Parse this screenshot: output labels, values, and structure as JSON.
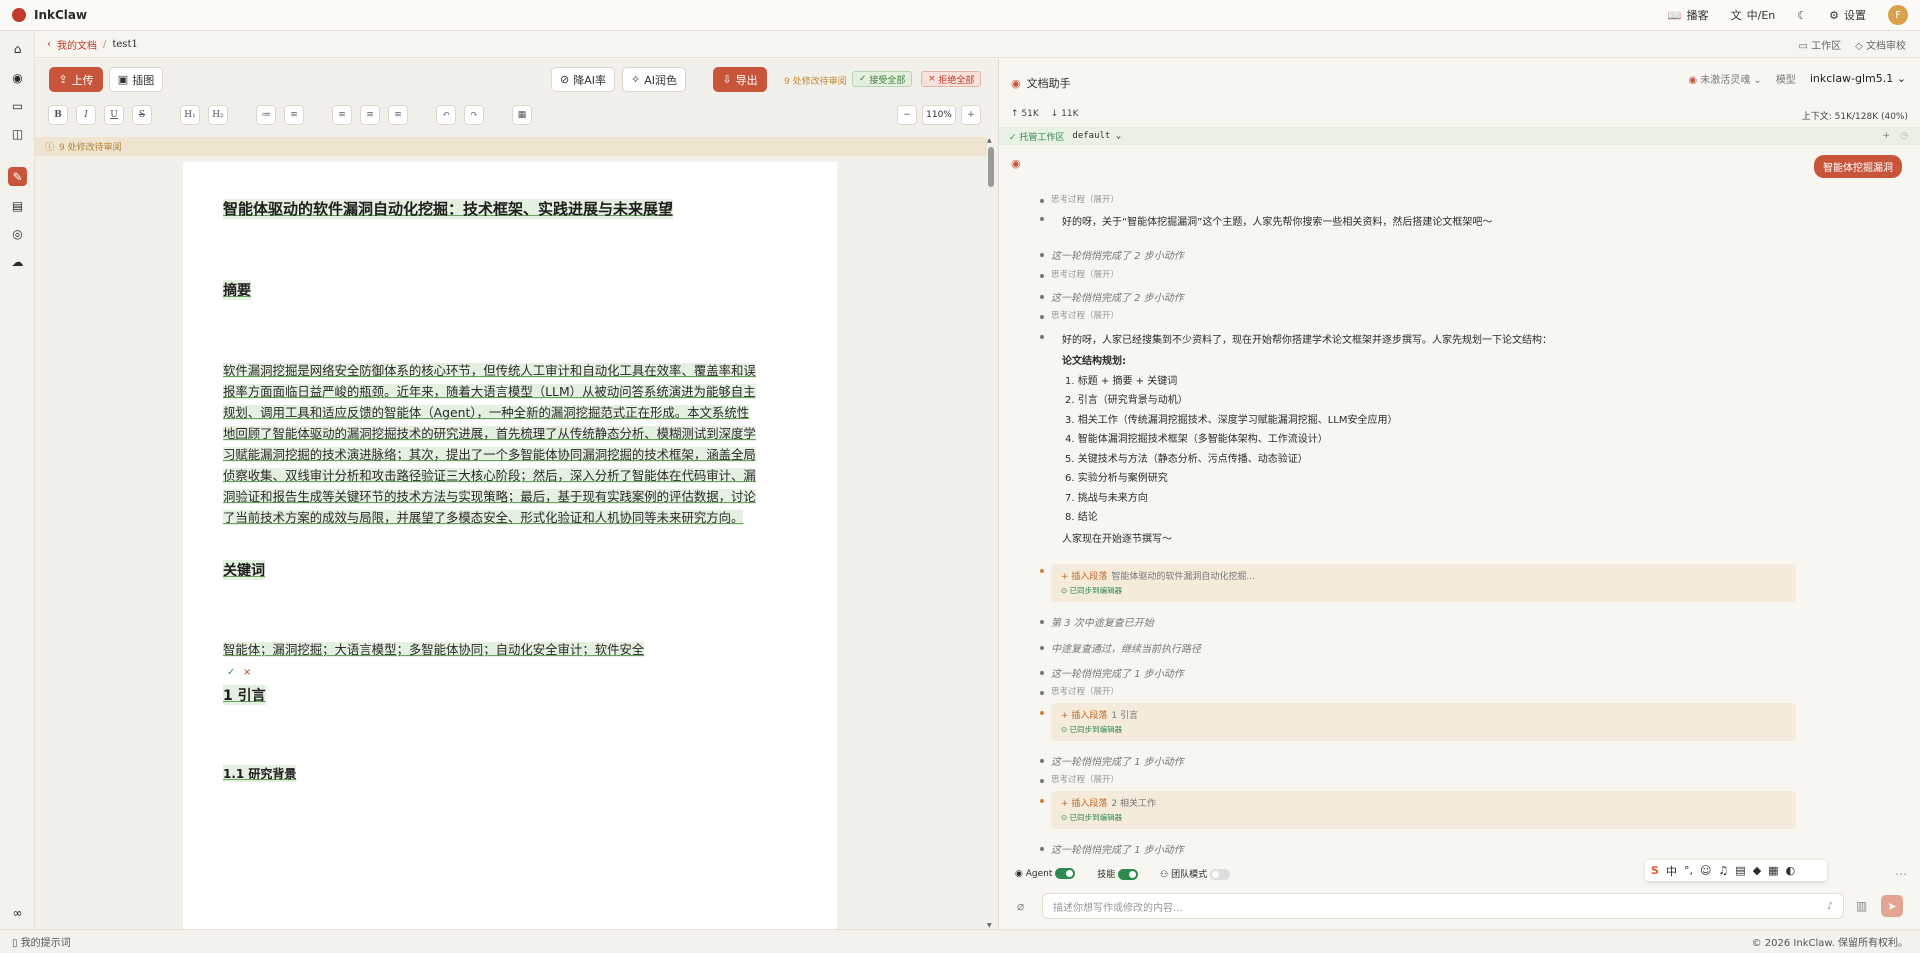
{
  "app": {
    "name": "InkClaw"
  },
  "topbar": {
    "blog": "播客",
    "lang": "中/En",
    "settings": "设置",
    "avatar": "F"
  },
  "breadcrumb": {
    "root": "我的文档",
    "sep": "/",
    "doc": "test1",
    "workspace": "工作区",
    "review": "文档审校"
  },
  "toolbar": {
    "upload": "上传",
    "insert_image": "插图",
    "reduce_ai": "降AI率",
    "ai_polish": "AI润色",
    "export": "导出",
    "pending": "9 处修改待审阅",
    "accept_all": "接受全部",
    "reject_all": "拒绝全部",
    "zoom": "110%",
    "format_buttons": [
      "B",
      "I",
      "U",
      "S",
      "H₁",
      "H₂",
      "≔",
      "≡",
      "≡",
      "≡",
      "≡",
      "↶",
      "↷",
      "▦"
    ]
  },
  "notice": "9 处修改待审阅",
  "document": {
    "title": "智能体驱动的软件漏洞自动化挖掘：技术框架、实践进展与未来展望",
    "abstract_heading": "摘要",
    "abstract_lines": [
      "软件漏洞挖掘是网络安全防御体系的核心环节，但传统人工审计和自动化工具在效率、覆盖率和误",
      "报率方面面临日益严峻的瓶颈。近年来，随着大语言模型（LLM）从被动问答系统演进为能够自主",
      "规划、调用工具和适应反馈的智能体（Agent），一种全新的漏洞挖掘范式正在形成。本文系统性",
      "地回顾了智能体驱动的漏洞挖掘技术的研究进展，首先梳理了从传统静态分析、模糊测试到深度学",
      "习赋能漏洞挖掘的技术演进脉络；其次，提出了一个多智能体协同漏洞挖掘的技术框架，涵盖全局",
      "侦察收集、双线审计分析和攻击路径验证三大核心阶段；然后，深入分析了智能体在代码审计、漏",
      "洞验证和报告生成等关键环节的技术方法与实现策略；最后，基于现有实践案例的评估数据，讨论",
      "了当前技术方案的成效与局限，并展望了多模态安全、形式化验证和人机协同等未来研究方向。"
    ],
    "keywords_heading": "关键词",
    "keywords": "智能体；漏洞挖掘；大语言模型；多智能体协同；自动化安全审计；软件安全",
    "accept_mark": "✓",
    "reject_mark": "×",
    "section1": "1 引言",
    "section1_1": "1.1 研究背景"
  },
  "assistant": {
    "title": "文档助手",
    "agent_status": "未激活灵魂",
    "model_label": "模型",
    "model": "inkclaw-glm5.1",
    "tokens_up": "↑ 51K",
    "tokens_down": "↓ 11K",
    "context": "上下文: 51K/128K (40%)",
    "workspace_status": "✓ 托管工作区",
    "workspace_name": "default",
    "user_message": "智能体挖掘漏洞",
    "think_label": "思考过程（展开）",
    "reply1": "好的呀，关于“智能体挖掘漏洞”这个主题，人家先帮你搜索一些相关资料，然后搭建论文框架吧～",
    "done2": "这一轮悄悄完成了 2 步小动作",
    "reply2": "好的呀，人家已经搜集到不少资料了，现在开始帮你搭建学术论文框架并逐步撰写。人家先规划一下论文结构：",
    "plan_title": "论文结构规划:",
    "plan_items": [
      "1. 标题 + 摘要 + 关键词",
      "2. 引言（研究背景与动机）",
      "3. 相关工作（传统漏洞挖掘技术、深度学习赋能漏洞挖掘、LLM安全应用）",
      "4. 智能体漏洞挖掘技术框架（多智能体架构、工作流设计）",
      "5. 关键技术与方法（静态分析、污点传播、动态验证）",
      "6. 实验分析与案例研究",
      "7. 挑战与未来方向",
      "8. 结论"
    ],
    "reply3": "人家现在开始逐节撰写～",
    "insert_label": "+ 插入段落",
    "insert1": "智能体驱动的软件漏洞自动化挖掘...",
    "synced": "⊙ 已同步到编辑器",
    "review3": "第 3 次中途复查已开始",
    "review_ok": "中途复查通过，继续当前执行路径",
    "done1": "这一轮悄悄完成了 1 步小动作",
    "insert2": "1 引言",
    "insert3": "2 相关工作",
    "agent_label": "Agent",
    "skill_label": "技能",
    "team_label": "团队模式",
    "input_placeholder": "描述你想写作或修改的内容..."
  },
  "footer": {
    "prompts": "我的提示词",
    "copyright": "© 2026 InkClaw. 保留所有权利。"
  }
}
